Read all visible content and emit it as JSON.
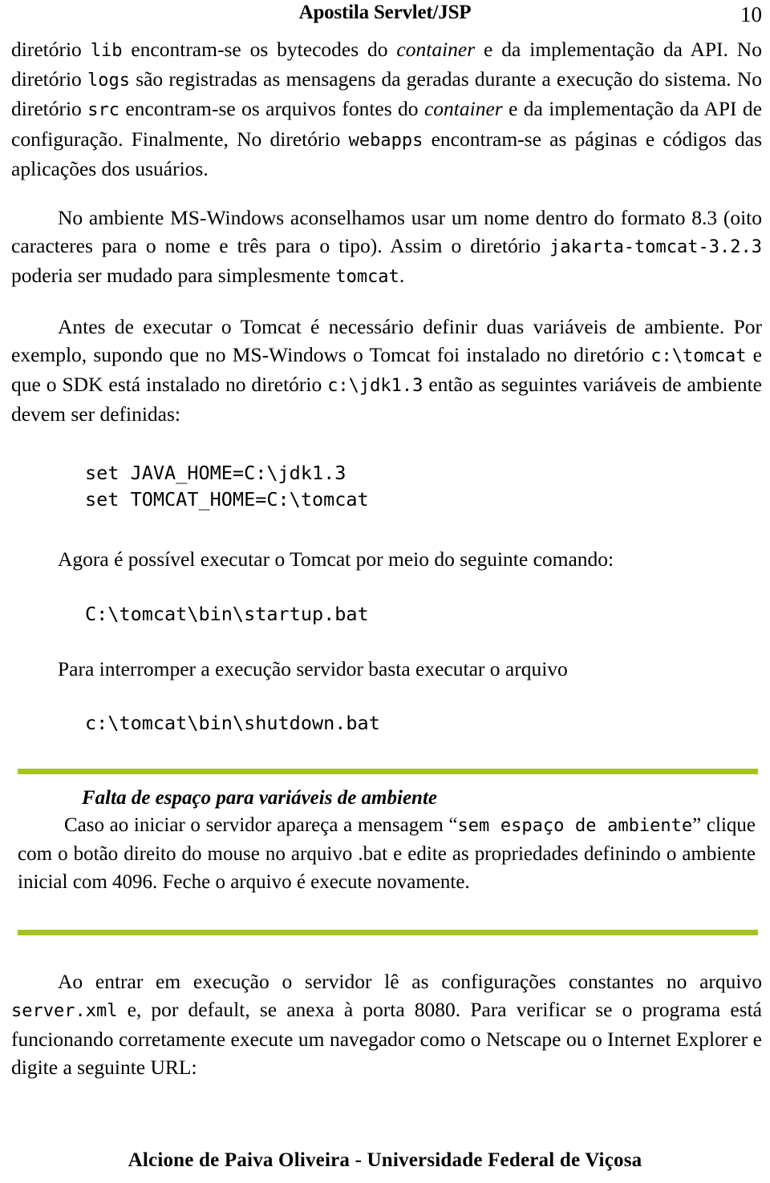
{
  "header": {
    "title": "Apostila Servlet/JSP",
    "page_number": "10"
  },
  "body": {
    "para1": {
      "s1": "diretório ",
      "c1": "lib",
      "s2": " encontram-se os bytecodes do ",
      "i1": "container",
      "s3": " e da implementação da API. No diretório ",
      "c2": "logs",
      "s4": " são registradas as mensagens da geradas durante a execução do sistema. No diretório ",
      "c3": "src",
      "s5": " encontram-se os arquivos fontes do ",
      "i2": "container",
      "s6": " e da implementação da API de configuração. Finalmente, No diretório ",
      "c4": "webapps",
      "s7": " encontram-se as páginas e códigos das aplicações dos usuários."
    },
    "para2": {
      "s1": "No ambiente MS-Windows aconselhamos usar um nome dentro do formato 8.3 (oito caracteres para o nome e três para o tipo). Assim o diretório ",
      "c1": "jakarta-tomcat-3.2.3",
      "s2": " poderia ser mudado para simplesmente ",
      "c2": "tomcat",
      "s3": "."
    },
    "para3": {
      "s1": "Antes de executar o Tomcat é necessário definir duas variáveis de ambiente. Por exemplo, supondo que no MS-Windows o Tomcat foi instalado no diretório ",
      "c1": "c:\\tomcat",
      "s2": " e que o SDK está instalado no diretório ",
      "c2": "c:\\jdk1.3",
      "s3": " então as seguintes variáveis de ambiente devem ser definidas:"
    },
    "code_env": "set JAVA_HOME=C:\\jdk1.3\nset TOMCAT_HOME=C:\\tomcat",
    "para4": "Agora é possível executar o Tomcat por meio do seguinte comando:",
    "code_startup": "C:\\tomcat\\bin\\startup.bat",
    "para5": "Para interromper a execução servidor basta executar o arquivo",
    "code_shutdown": "c:\\tomcat\\bin\\shutdown.bat",
    "para6": {
      "s1": "Ao entrar em execução o servidor lê as configurações constantes no arquivo ",
      "c1": "server.xml",
      "s2": " e, por default, se anexa à porta 8080. Para  verificar se o programa está funcionando corretamente execute um navegador como o Netscape ou o Internet Explorer e digite a seguinte URL:"
    }
  },
  "callout": {
    "title": "Falta de espaço para variáveis de ambiente",
    "text": {
      "s1": "Caso ao iniciar o servidor apareça a mensagem “",
      "c1": "sem espaço de ambiente",
      "s2": "” clique com o botão direito do mouse no arquivo .bat e edite as propriedades definindo o ambiente inicial com 4096. Feche o arquivo é execute novamente."
    },
    "accent_color": "#a4c520"
  },
  "footer": {
    "text": "Alcione de Paiva Oliveira - Universidade Federal de Viçosa"
  }
}
